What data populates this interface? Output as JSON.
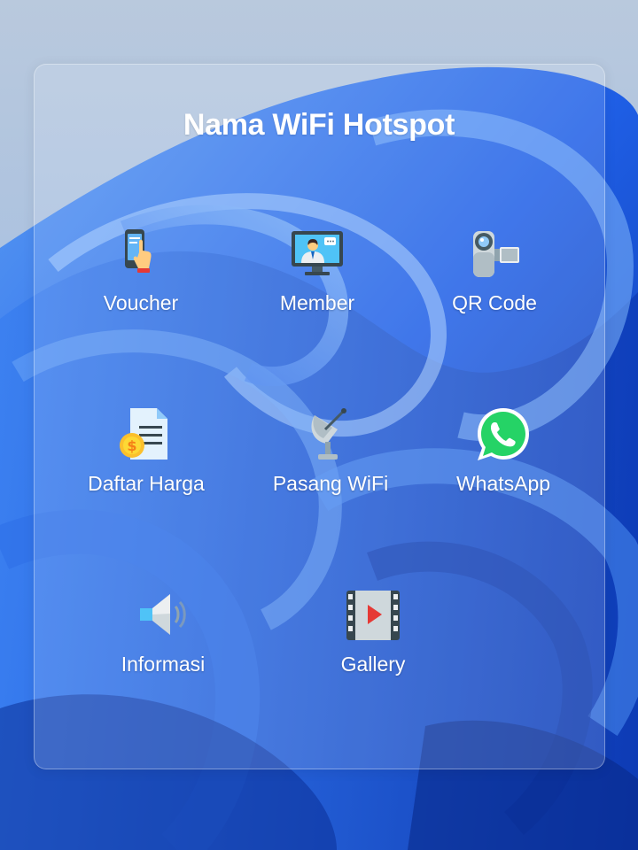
{
  "page": {
    "title": "Nama WiFi Hotspot"
  },
  "menu": {
    "items": [
      {
        "label": "Voucher",
        "icon": "phone-tap-icon"
      },
      {
        "label": "Member",
        "icon": "monitor-user-icon"
      },
      {
        "label": "QR Code",
        "icon": "video-camera-icon"
      },
      {
        "label": "Daftar Harga",
        "icon": "price-list-icon"
      },
      {
        "label": "Pasang WiFi",
        "icon": "satellite-dish-icon"
      },
      {
        "label": "WhatsApp",
        "icon": "whatsapp-icon"
      },
      {
        "label": "Informasi",
        "icon": "speaker-icon"
      },
      {
        "label": "Gallery",
        "icon": "film-play-icon"
      }
    ]
  },
  "colors": {
    "wallpaper_primary": "#1a57e0",
    "wallpaper_light": "#9cc2f5",
    "text": "#ffffff",
    "whatsapp_green": "#25d366"
  }
}
